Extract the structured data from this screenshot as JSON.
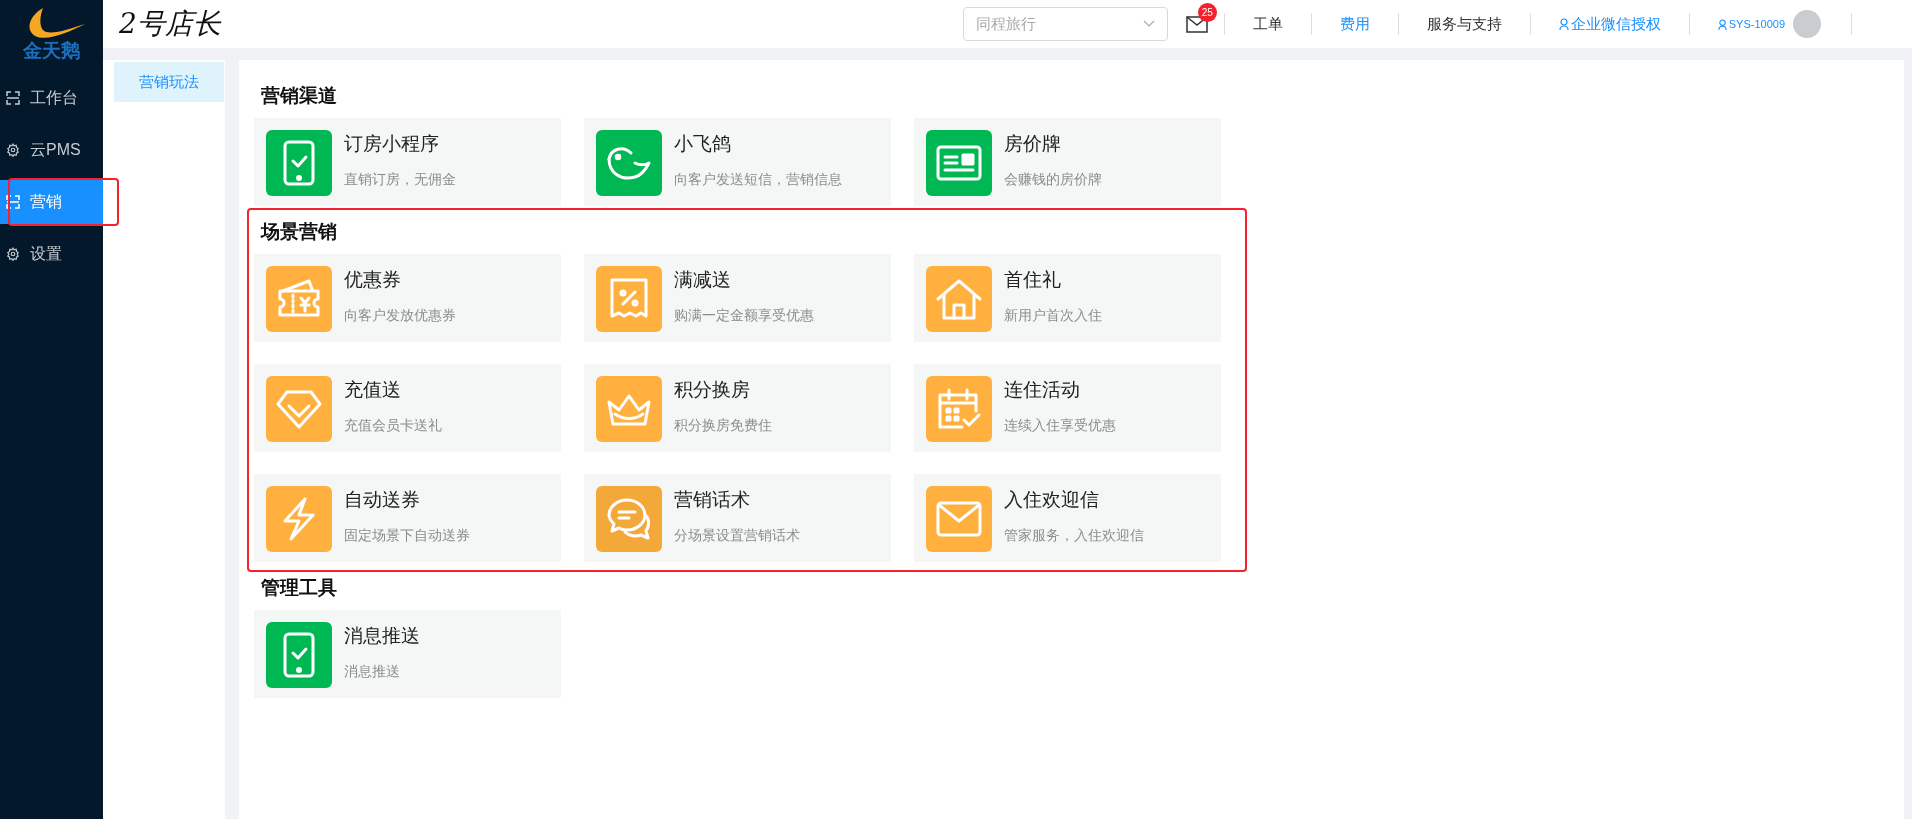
{
  "logo": {
    "text": "金天鹅"
  },
  "sidebar": {
    "items": [
      {
        "label": "工作台",
        "kind": "frame",
        "selected": false,
        "highlighted": false
      },
      {
        "label": "云PMS",
        "kind": "gear",
        "selected": false,
        "highlighted": false
      },
      {
        "label": "营销",
        "kind": "frame",
        "selected": true,
        "highlighted": true
      },
      {
        "label": "设置",
        "kind": "gear",
        "selected": false,
        "highlighted": false
      }
    ]
  },
  "header": {
    "title": "2号店长",
    "store_select": {
      "placeholder": "同程旅行"
    },
    "mail_badge": "25",
    "links": [
      {
        "label": "工单",
        "color": "#333333",
        "user_icon": false
      },
      {
        "label": "费用",
        "color": "#1890ff",
        "user_icon": false
      },
      {
        "label": "服务与支持",
        "color": "#333333",
        "user_icon": false
      },
      {
        "label": "企业微信授权",
        "color": "#1890ff",
        "user_icon": true
      }
    ],
    "account": "SYS-10009"
  },
  "subnav": {
    "items": [
      {
        "label": "营销玩法",
        "selected": true
      }
    ]
  },
  "sections": [
    {
      "title": "营销渠道",
      "highlighted": false,
      "cards": [
        {
          "kind": "phone",
          "color": "#00b853",
          "title": "订房小程序",
          "desc": "直销订房，无佣金"
        },
        {
          "kind": "bird",
          "color": "#00b853",
          "title": "小飞鸽",
          "desc": "向客户发送短信，营销信息"
        },
        {
          "kind": "board",
          "color": "#00b853",
          "title": "房价牌",
          "desc": "会赚钱的房价牌"
        }
      ]
    },
    {
      "title": "场景营销",
      "highlighted": true,
      "cards": [
        {
          "kind": "coupon",
          "color": "#ffb03f",
          "title": "优惠券",
          "desc": "向客户发放优惠券"
        },
        {
          "kind": "percent",
          "color": "#ffb03f",
          "title": "满减送",
          "desc": "购满一定金额享受优惠"
        },
        {
          "kind": "house",
          "color": "#ffb03f",
          "title": "首住礼",
          "desc": "新用户首次入住"
        },
        {
          "kind": "diamond",
          "color": "#ffb03f",
          "title": "充值送",
          "desc": "充值会员卡送礼"
        },
        {
          "kind": "crown",
          "color": "#ffb03f",
          "title": "积分换房",
          "desc": "积分换房免费住"
        },
        {
          "kind": "calendar",
          "color": "#ffb03f",
          "title": "连住活动",
          "desc": "连续入住享受优惠"
        },
        {
          "kind": "bolt",
          "color": "#ffb03f",
          "title": "自动送券",
          "desc": "固定场景下自动送券"
        },
        {
          "kind": "chat",
          "color": "#f5a83a",
          "title": "营销话术",
          "desc": "分场景设置营销话术"
        },
        {
          "kind": "mail",
          "color": "#ffb03f",
          "title": "入住欢迎信",
          "desc": "管家服务，入住欢迎信"
        }
      ]
    },
    {
      "title": "管理工具",
      "highlighted": false,
      "cards": [
        {
          "kind": "phone",
          "color": "#00b853",
          "title": "消息推送",
          "desc": "消息推送"
        }
      ]
    }
  ]
}
